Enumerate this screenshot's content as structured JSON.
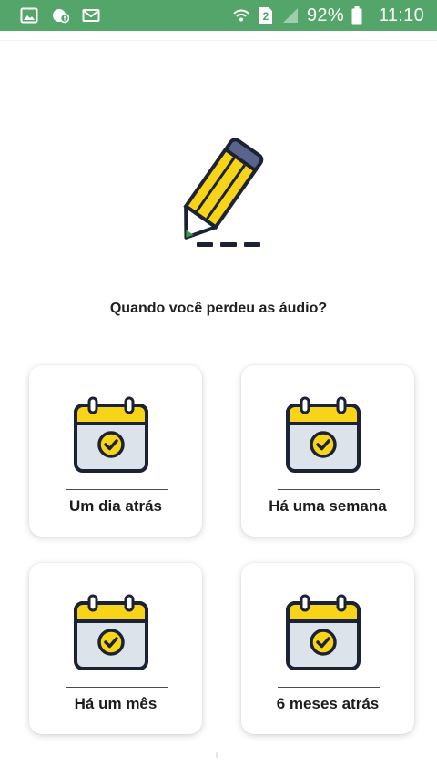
{
  "status_bar": {
    "left_icons": [
      "image-icon",
      "chat-notification-icon",
      "mail-icon"
    ],
    "right_icons": [
      "wifi-icon",
      "sim-2-icon",
      "signal-icon",
      "battery-icon"
    ],
    "sim_slot": "2",
    "battery": "92%",
    "time": "11:10",
    "background_color": "#53a56a"
  },
  "hero": {
    "icon": "pencil-icon",
    "colors": {
      "body": "#f7d417",
      "cap": "#5a6389",
      "outline": "#1b2233",
      "tip": "#3aa14a"
    }
  },
  "question": "Quando você perdeu as áudio?",
  "options": [
    {
      "label": "Um dia atrás",
      "icon": "calendar-check-icon"
    },
    {
      "label": "Há uma semana",
      "icon": "calendar-check-icon"
    },
    {
      "label": "Há um mês",
      "icon": "calendar-check-icon"
    },
    {
      "label": "6 meses atrás",
      "icon": "calendar-check-icon"
    }
  ],
  "calendar_colors": {
    "header": "#f7d417",
    "body": "#dde3ea",
    "outline": "#1b2233"
  }
}
